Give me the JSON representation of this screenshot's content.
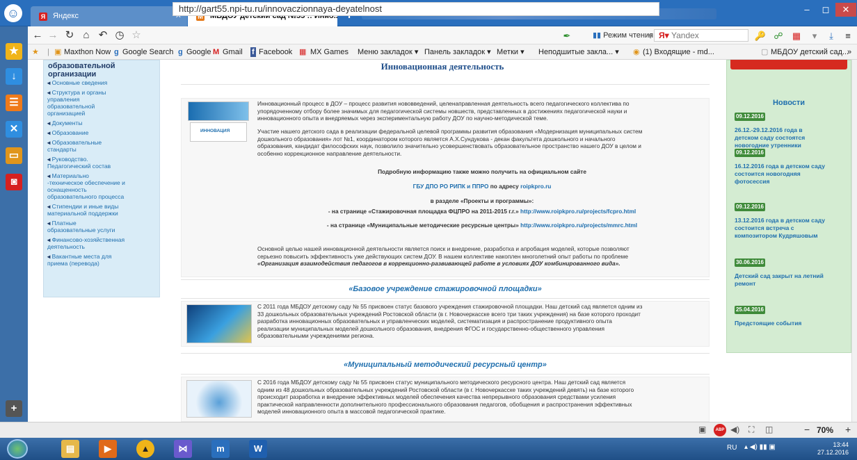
{
  "window": {
    "tabs": [
      {
        "label": "Яндекс",
        "fav": "Я"
      },
      {
        "label": "МБДОУ детский сад №55 :: Инно...",
        "fav": "M"
      }
    ],
    "close_glyph": "✕",
    "new_tab_glyph": "✛"
  },
  "toolbar": {
    "url": "http://gart55.npi-tu.ru/innovaczionnaya-deyatelnost",
    "reader_mode": "Режим чтения",
    "search_engine": "Yandex"
  },
  "bookmarks": [
    "Maxthon Now",
    "Google Search",
    "Google",
    "Gmail",
    "Facebook",
    "MX Games",
    "Меню закладок ▾",
    "Панель закладок ▾",
    "Метки ▾",
    "Неподшитые закла... ▾",
    "(1) Входящие - md...",
    "МБДОУ детский сад..."
  ],
  "left_menu": {
    "heading": [
      "образовательной",
      "организации"
    ],
    "items": [
      "Основные сведения",
      "Структура и органы",
      "управления",
      "образовательной",
      "организацией",
      "Документы",
      "Образование",
      "Образовательные",
      "стандарты",
      "Руководство.",
      "Педагогический состав",
      "Материально",
      "-техническое обеспечение и",
      "оснащенность",
      "образовательного процесса",
      "Стипендии и иные виды",
      "материальной поддержки",
      "Платные",
      "образовательные услуги",
      "Финансово-хозяйственная",
      "деятельность",
      "Вакантные места для",
      "приема (перевода)"
    ]
  },
  "main": {
    "title": "Инновационная деятельность",
    "thumb1_caption": "ИННОВАЦИЯ",
    "intro_p1": [
      "Инновационный процесс в ДОУ – процесс развития нововведений, целенаправленная деятельность всего педагогического коллектива по",
      "упорядоченному отбору более значимых для педагогической системы новшеств, представленных в достижениях педагогической науки и",
      "инновационного опыта и внедряемых через экспериментальную работу ДОУ по научно-методической теме."
    ],
    "intro_p2": [
      "Участие нашего детского сада в реализации федеральной целевой программы развития образования «Модернизация муниципальных систем",
      "дошкольного образования» лот №1, координатором которого является А.Х.Сундукова - декан факультета дошкольного и начального",
      "образования, кандидат философских наук, позволило значительно усовершенствовать образовательное пространство нашего ДОУ в целом и",
      "особенно коррекционное направление деятельности."
    ],
    "more_info": "Подробную информацию также можно получить на официальном сайте",
    "org_link": "ГБУ ДПО РО РИПК и ППРО",
    "by_address": "по адресу",
    "addr_link": "roipkpro.ru",
    "section_label": "в разделе «Проекты и программы»:",
    "line1_text": "- на странице «Стажировочная площадка ФЦПРО на 2011-2015 г.г.»",
    "line1_link": "http://www.roipkpro.ru/projects/fcpro.html",
    "line2_text": "- на странице «Муниципальные методические ресурсные центры»",
    "line2_link": "http://www.roipkpro.ru/projects/mmrc.html",
    "goal": [
      "Основной целью нашей инновационной деятельности является поиск и внедрение, разработка и апробация моделей, которые позволяют",
      "серьезно повысить эффективность уже действующих систем ДОУ. В нашем коллективе накоплен многолетний опыт работы по проблеме"
    ],
    "goal_italic": "«Организация взаимодействия педагогов в коррекционно-развивающей работе в условиях ДОУ комбинированного вида».",
    "sub1": "«Базовое учреждение стажировочной площадки»",
    "sub1_text": [
      "С 2011 года МБДОУ детскому саду № 55 присвоен статус базового учреждения стажировочной площадки. Наш детский сад является одним из",
      "33 дошкольных образовательных учреждений Ростовской области (в г. Новочеркасске всего три таких учреждения) на базе которого проходит",
      "разработка инновационных образовательных и управленческих моделей, систематизация и распространение продуктивного опыта",
      "реализации муниципальных моделей дошкольного образования, внедрения ФГОС и государственно-общественного управления",
      "образовательными учреждениями региона."
    ],
    "sub2": "«Муниципальный методический ресурсный центр»",
    "sub2_text": [
      "С 2016 года МБДОУ детскому саду № 55 присвоен статус муниципального методического ресурсного центра. Наш детский сад является",
      "одним из 48 дошкольных образовательных учреждений Ростовской области (в г. Новочеркасске таких учреждений девять) на базе которого",
      "происходит разработка и внедрение эффективных моделей обеспечения качества непрерывного образования средствами усиления",
      "практической направленности дополнительного профессионального образования педагогов, обобщения и распространения эффективных",
      "моделей инновационного опыта в массовой педагогической практике."
    ]
  },
  "news": {
    "title": "Новости",
    "items": [
      {
        "date": "09.12.2016",
        "text": [
          "26.12.-29.12.2016 года в",
          "детском саду состоятся",
          "новогодние утренники"
        ]
      },
      {
        "date": "09.12.2016",
        "text": [
          "16.12.2016 года в детском саду",
          "состоится новогодняя",
          "фотосессия"
        ]
      },
      {
        "date": "09.12.2016",
        "text": [
          "13.12.2016 года в детском саду",
          "состоится встреча с",
          "композитором Кудряшовым"
        ]
      },
      {
        "date": "30.06.2016",
        "text": [
          "Детский сад закрыт на летний",
          "ремонт"
        ]
      },
      {
        "date": "25.04.2016",
        "text": [
          "Предстоящие события"
        ]
      }
    ]
  },
  "status": {
    "zoom": "70%",
    "minus": "−",
    "plus": "+"
  },
  "taskbar": {
    "lang": "RU",
    "time": "13:44",
    "date": "27.12.2016"
  },
  "colors": {
    "chrome": "#2a6fbd",
    "link": "#1f6fae",
    "news_bg": "#d4ecd2",
    "menu_bg": "#d9ecf7"
  }
}
